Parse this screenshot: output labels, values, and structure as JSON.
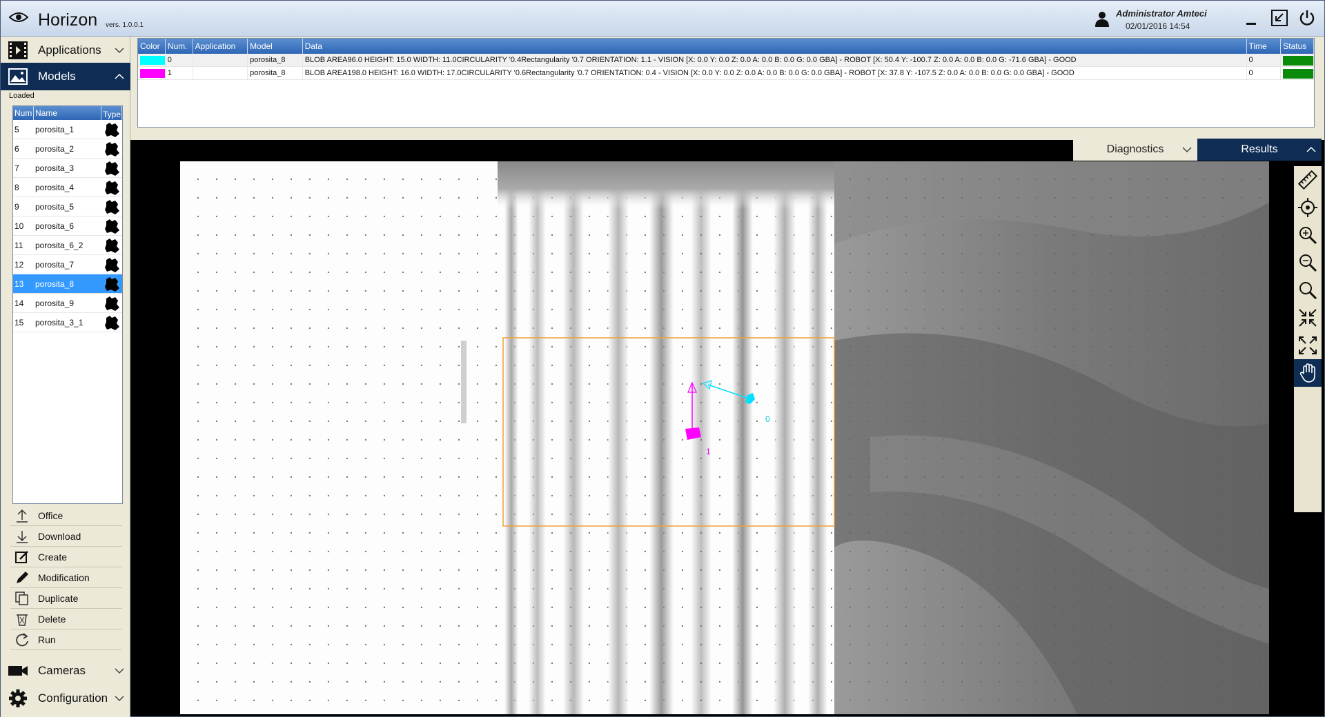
{
  "app": {
    "title": "Horizon",
    "version": "vers. 1.0.0.1"
  },
  "user": {
    "name": "Administrator Amteci",
    "datetime": "02/01/2016 14:54"
  },
  "sidebar": {
    "menus": [
      {
        "label": "Applications"
      },
      {
        "label": "Models"
      },
      {
        "label": "Cameras"
      },
      {
        "label": "Configuration"
      }
    ],
    "loaded_label": "Loaded",
    "models_table": {
      "columns": [
        "Num",
        "Name",
        "Type"
      ],
      "rows": [
        {
          "num": "5",
          "name": "porosita_1"
        },
        {
          "num": "6",
          "name": "porosita_2"
        },
        {
          "num": "7",
          "name": "porosita_3"
        },
        {
          "num": "8",
          "name": "porosita_4"
        },
        {
          "num": "9",
          "name": "porosita_5"
        },
        {
          "num": "10",
          "name": "porosita_6"
        },
        {
          "num": "11",
          "name": "porosita_6_2"
        },
        {
          "num": "12",
          "name": "porosita_7"
        },
        {
          "num": "13",
          "name": "porosita_8",
          "selected": true
        },
        {
          "num": "14",
          "name": "porosita_9"
        },
        {
          "num": "15",
          "name": "porosita_3_1"
        }
      ]
    },
    "actions": [
      {
        "label": "Office",
        "icon": "upload-icon"
      },
      {
        "label": "Download",
        "icon": "download-icon"
      },
      {
        "label": "Create",
        "icon": "create-icon"
      },
      {
        "label": "Modification",
        "icon": "pencil-icon"
      },
      {
        "label": "Duplicate",
        "icon": "duplicate-icon"
      },
      {
        "label": "Delete",
        "icon": "trash-icon"
      },
      {
        "label": "Run",
        "icon": "refresh-icon"
      }
    ]
  },
  "results": {
    "columns": [
      "Color",
      "Num.",
      "Application",
      "Model",
      "Data",
      "Time",
      "Status"
    ],
    "rows": [
      {
        "color": "#00ffff",
        "num": "0",
        "application": "",
        "model": "porosita_8",
        "data": "BLOB AREA96.0 HEIGHT: 15.0 WIDTH: 11.0CIRCULARITY '0.4Rectangularity '0.7 ORIENTATION: 1.1 - VISION [X: 0.0 Y: 0.0 Z: 0.0 A: 0.0 B: 0.0 G: 0.0 GBA] - ROBOT [X: 50.4 Y: -100.7 Z: 0.0 A: 0.0 B: 0.0 G: -71.6 GBA] - GOOD",
        "time": "0",
        "status_color": "#0a8a0a"
      },
      {
        "color": "#ff00ff",
        "num": "1",
        "application": "",
        "model": "porosita_8",
        "data": "BLOB AREA198.0 HEIGHT: 16.0 WIDTH: 17.0CIRCULARITY '0.6Rectangularity '0.7 ORIENTATION: 0.4 - VISION [X: 0.0 Y: 0.0 Z: 0.0 A: 0.0 B: 0.0 G: 0.0 GBA] - ROBOT [X: 37.8 Y: -107.5 Z: 0.0 A: 0.0 B: 0.0 G: 0.0 GBA] - GOOD",
        "time": "0",
        "status_color": "#0a8a0a"
      }
    ]
  },
  "tabs": {
    "diagnostics": "Diagnostics",
    "results": "Results"
  },
  "overlay": {
    "label_0": "0",
    "label_1": "1"
  },
  "toolbar": {
    "tools": [
      "ruler-icon",
      "target-icon",
      "zoom-in-icon",
      "zoom-out-icon",
      "zoom-icon",
      "fit-icon",
      "expand-icon",
      "hand-icon"
    ],
    "active": "hand-icon"
  }
}
